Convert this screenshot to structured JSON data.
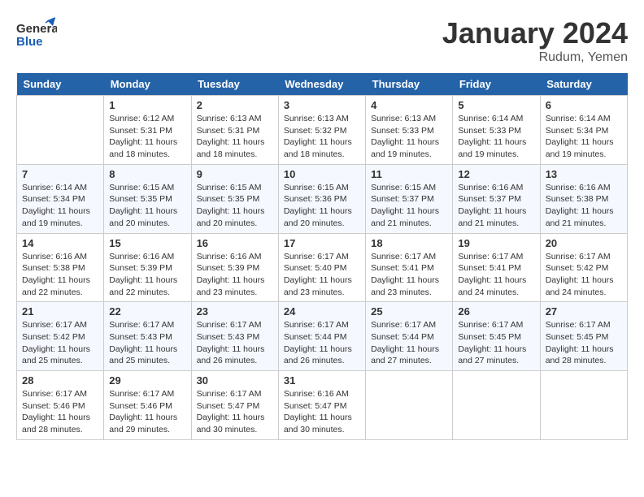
{
  "header": {
    "logo_general": "General",
    "logo_blue": "Blue",
    "month": "January 2024",
    "location": "Rudum, Yemen"
  },
  "days_of_week": [
    "Sunday",
    "Monday",
    "Tuesday",
    "Wednesday",
    "Thursday",
    "Friday",
    "Saturday"
  ],
  "weeks": [
    [
      {
        "num": "",
        "info": ""
      },
      {
        "num": "1",
        "info": "Sunrise: 6:12 AM\nSunset: 5:31 PM\nDaylight: 11 hours\nand 18 minutes."
      },
      {
        "num": "2",
        "info": "Sunrise: 6:13 AM\nSunset: 5:31 PM\nDaylight: 11 hours\nand 18 minutes."
      },
      {
        "num": "3",
        "info": "Sunrise: 6:13 AM\nSunset: 5:32 PM\nDaylight: 11 hours\nand 18 minutes."
      },
      {
        "num": "4",
        "info": "Sunrise: 6:13 AM\nSunset: 5:33 PM\nDaylight: 11 hours\nand 19 minutes."
      },
      {
        "num": "5",
        "info": "Sunrise: 6:14 AM\nSunset: 5:33 PM\nDaylight: 11 hours\nand 19 minutes."
      },
      {
        "num": "6",
        "info": "Sunrise: 6:14 AM\nSunset: 5:34 PM\nDaylight: 11 hours\nand 19 minutes."
      }
    ],
    [
      {
        "num": "7",
        "info": "Sunrise: 6:14 AM\nSunset: 5:34 PM\nDaylight: 11 hours\nand 19 minutes."
      },
      {
        "num": "8",
        "info": "Sunrise: 6:15 AM\nSunset: 5:35 PM\nDaylight: 11 hours\nand 20 minutes."
      },
      {
        "num": "9",
        "info": "Sunrise: 6:15 AM\nSunset: 5:35 PM\nDaylight: 11 hours\nand 20 minutes."
      },
      {
        "num": "10",
        "info": "Sunrise: 6:15 AM\nSunset: 5:36 PM\nDaylight: 11 hours\nand 20 minutes."
      },
      {
        "num": "11",
        "info": "Sunrise: 6:15 AM\nSunset: 5:37 PM\nDaylight: 11 hours\nand 21 minutes."
      },
      {
        "num": "12",
        "info": "Sunrise: 6:16 AM\nSunset: 5:37 PM\nDaylight: 11 hours\nand 21 minutes."
      },
      {
        "num": "13",
        "info": "Sunrise: 6:16 AM\nSunset: 5:38 PM\nDaylight: 11 hours\nand 21 minutes."
      }
    ],
    [
      {
        "num": "14",
        "info": "Sunrise: 6:16 AM\nSunset: 5:38 PM\nDaylight: 11 hours\nand 22 minutes."
      },
      {
        "num": "15",
        "info": "Sunrise: 6:16 AM\nSunset: 5:39 PM\nDaylight: 11 hours\nand 22 minutes."
      },
      {
        "num": "16",
        "info": "Sunrise: 6:16 AM\nSunset: 5:39 PM\nDaylight: 11 hours\nand 23 minutes."
      },
      {
        "num": "17",
        "info": "Sunrise: 6:17 AM\nSunset: 5:40 PM\nDaylight: 11 hours\nand 23 minutes."
      },
      {
        "num": "18",
        "info": "Sunrise: 6:17 AM\nSunset: 5:41 PM\nDaylight: 11 hours\nand 23 minutes."
      },
      {
        "num": "19",
        "info": "Sunrise: 6:17 AM\nSunset: 5:41 PM\nDaylight: 11 hours\nand 24 minutes."
      },
      {
        "num": "20",
        "info": "Sunrise: 6:17 AM\nSunset: 5:42 PM\nDaylight: 11 hours\nand 24 minutes."
      }
    ],
    [
      {
        "num": "21",
        "info": "Sunrise: 6:17 AM\nSunset: 5:42 PM\nDaylight: 11 hours\nand 25 minutes."
      },
      {
        "num": "22",
        "info": "Sunrise: 6:17 AM\nSunset: 5:43 PM\nDaylight: 11 hours\nand 25 minutes."
      },
      {
        "num": "23",
        "info": "Sunrise: 6:17 AM\nSunset: 5:43 PM\nDaylight: 11 hours\nand 26 minutes."
      },
      {
        "num": "24",
        "info": "Sunrise: 6:17 AM\nSunset: 5:44 PM\nDaylight: 11 hours\nand 26 minutes."
      },
      {
        "num": "25",
        "info": "Sunrise: 6:17 AM\nSunset: 5:44 PM\nDaylight: 11 hours\nand 27 minutes."
      },
      {
        "num": "26",
        "info": "Sunrise: 6:17 AM\nSunset: 5:45 PM\nDaylight: 11 hours\nand 27 minutes."
      },
      {
        "num": "27",
        "info": "Sunrise: 6:17 AM\nSunset: 5:45 PM\nDaylight: 11 hours\nand 28 minutes."
      }
    ],
    [
      {
        "num": "28",
        "info": "Sunrise: 6:17 AM\nSunset: 5:46 PM\nDaylight: 11 hours\nand 28 minutes."
      },
      {
        "num": "29",
        "info": "Sunrise: 6:17 AM\nSunset: 5:46 PM\nDaylight: 11 hours\nand 29 minutes."
      },
      {
        "num": "30",
        "info": "Sunrise: 6:17 AM\nSunset: 5:47 PM\nDaylight: 11 hours\nand 30 minutes."
      },
      {
        "num": "31",
        "info": "Sunrise: 6:16 AM\nSunset: 5:47 PM\nDaylight: 11 hours\nand 30 minutes."
      },
      {
        "num": "",
        "info": ""
      },
      {
        "num": "",
        "info": ""
      },
      {
        "num": "",
        "info": ""
      }
    ]
  ]
}
